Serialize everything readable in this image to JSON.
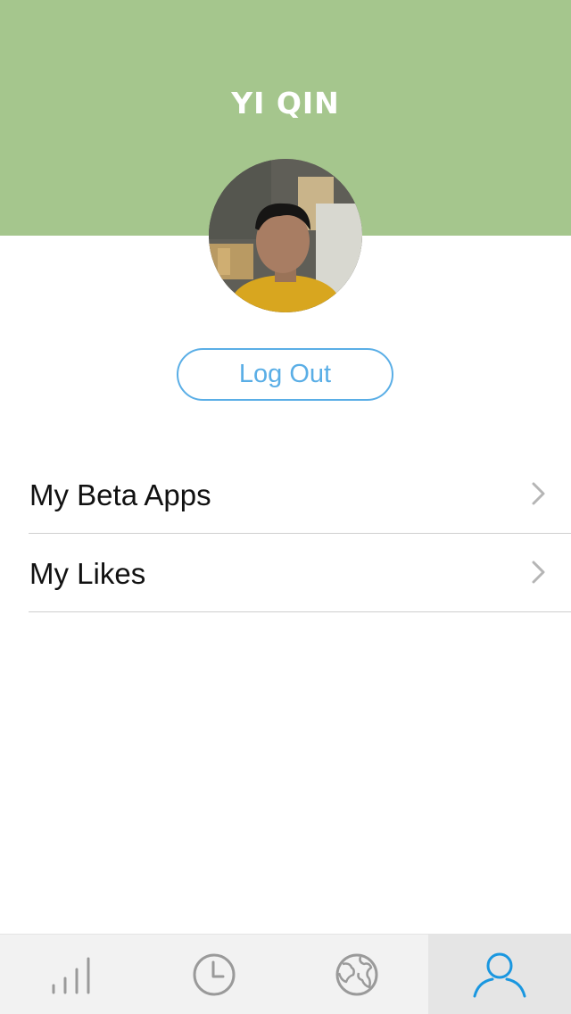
{
  "header": {
    "title": "YI QIN",
    "background_color": "#a5c68d"
  },
  "profile": {
    "avatar_icon": "user-photo"
  },
  "logout_button": {
    "label": "Log Out",
    "color": "#5aaee6"
  },
  "menu": {
    "items": [
      {
        "label": "My Beta Apps",
        "icon": "chevron-right-icon"
      },
      {
        "label": "My Likes",
        "icon": "chevron-right-icon"
      }
    ]
  },
  "tabbar": {
    "tabs": [
      {
        "icon": "signal-bars-icon",
        "active": false
      },
      {
        "icon": "clock-icon",
        "active": false
      },
      {
        "icon": "globe-icon",
        "active": false
      },
      {
        "icon": "user-icon",
        "active": true
      }
    ],
    "active_color": "#1a97e0",
    "inactive_color": "#9a9a9a"
  }
}
